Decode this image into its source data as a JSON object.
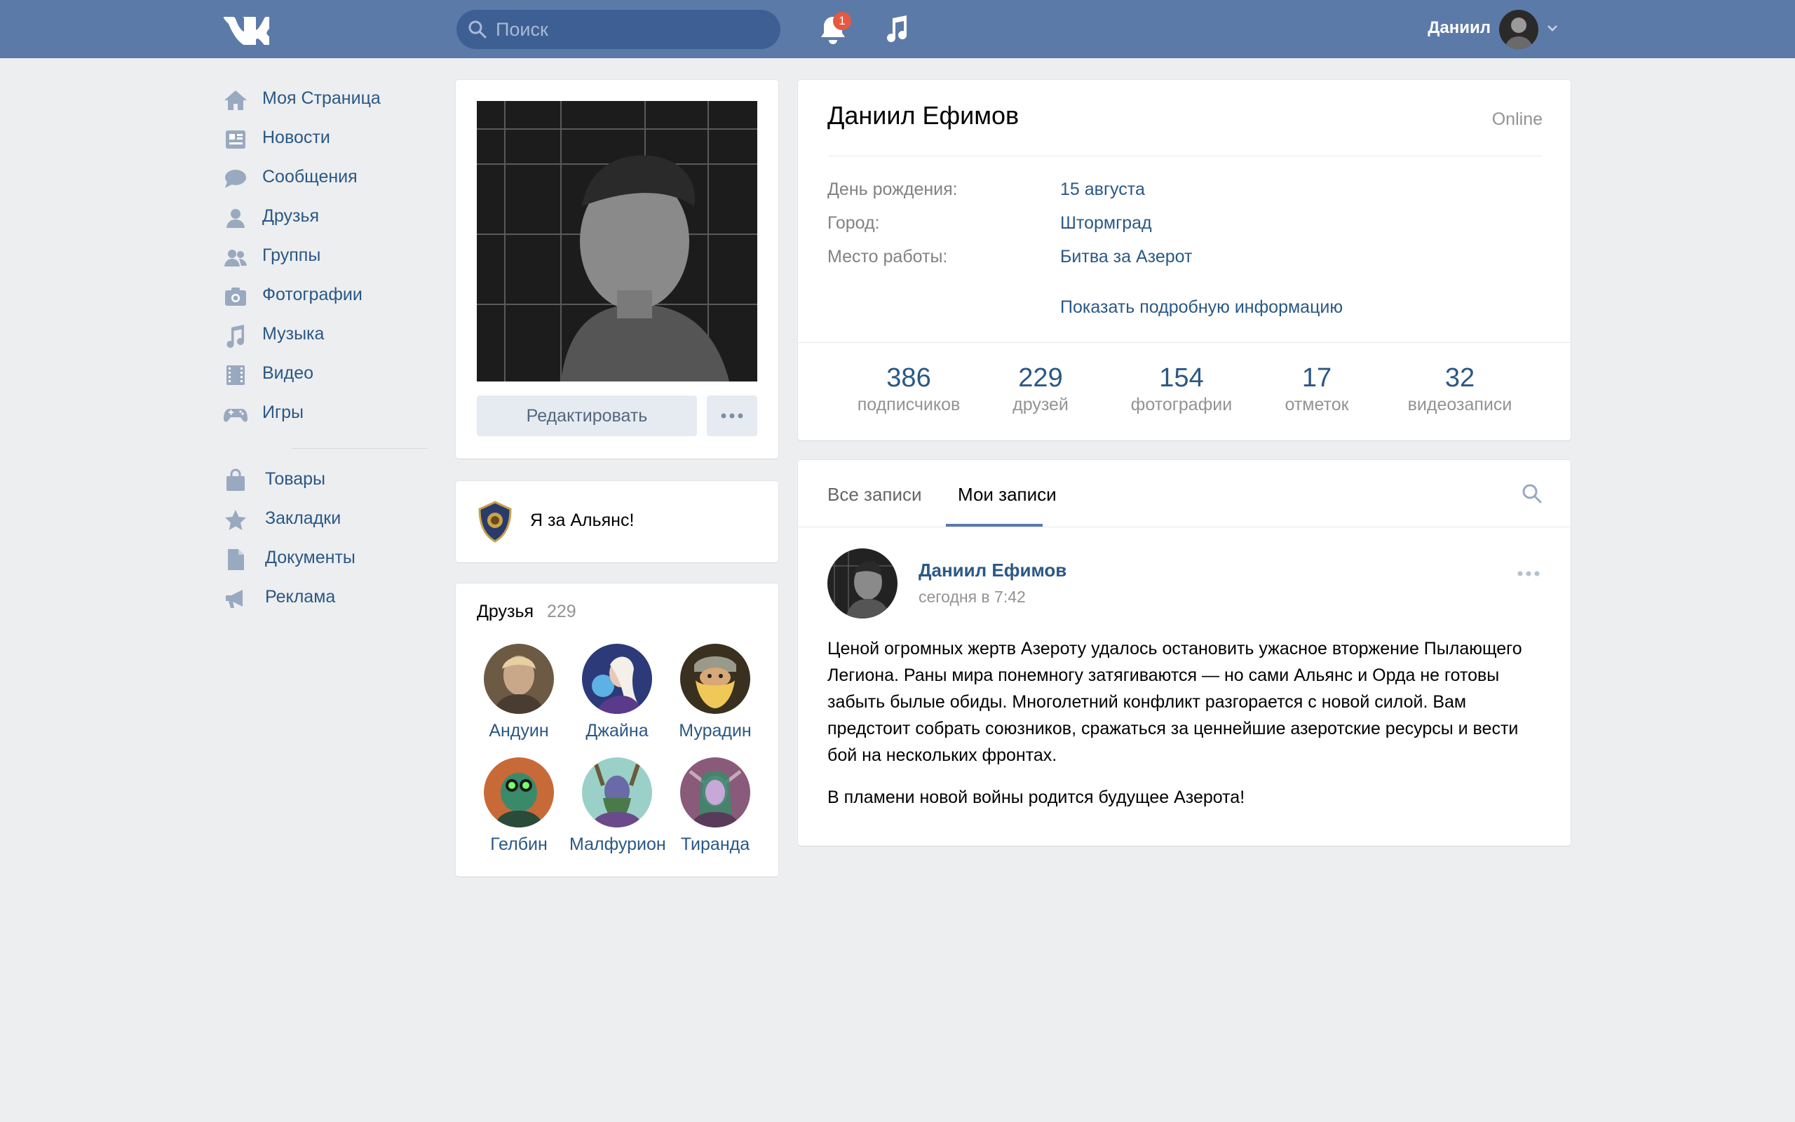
{
  "header": {
    "search_placeholder": "Поиск",
    "notifications_count": "1",
    "user_name": "Даниил",
    "icons": [
      "vk-logo-icon",
      "search-icon",
      "bell-icon",
      "music-icon",
      "chevron-down-icon"
    ],
    "colors": {
      "bar": "#5b7aa8",
      "search_bg": "#3e5f93",
      "badge": "#e55940"
    }
  },
  "nav": {
    "items": [
      {
        "label": "Моя Страница",
        "icon": "home-icon"
      },
      {
        "label": "Новости",
        "icon": "news-icon"
      },
      {
        "label": "Сообщения",
        "icon": "messages-icon"
      },
      {
        "label": "Друзья",
        "icon": "user-icon"
      },
      {
        "label": "Группы",
        "icon": "groups-icon"
      },
      {
        "label": "Фотографии",
        "icon": "camera-icon"
      },
      {
        "label": "Музыка",
        "icon": "music-icon"
      },
      {
        "label": "Видео",
        "icon": "film-icon"
      },
      {
        "label": "Игры",
        "icon": "gamepad-icon"
      }
    ],
    "extra_items": [
      {
        "label": "Товары",
        "icon": "bag-icon"
      },
      {
        "label": "Закладки",
        "icon": "star-icon"
      },
      {
        "label": "Документы",
        "icon": "document-icon"
      },
      {
        "label": "Реклама",
        "icon": "megaphone-icon"
      }
    ]
  },
  "profile": {
    "edit_label": "Редактировать",
    "status_prefix": "Я за ",
    "status_bold": "Альянс!",
    "name": "Даниил Ефимов",
    "online": "Online",
    "info": [
      {
        "key": "День рождения:",
        "value": "15 августа"
      },
      {
        "key": "Город:",
        "value": "Штормград"
      },
      {
        "key": "Место работы:",
        "value": "Битва за Азерот"
      }
    ],
    "show_more": "Показать подробную информацию",
    "counters": [
      {
        "num": "386",
        "label": "подписчиков"
      },
      {
        "num": "229",
        "label": "друзей"
      },
      {
        "num": "154",
        "label": "фотографии"
      },
      {
        "num": "17",
        "label": "отметок"
      },
      {
        "num": "32",
        "label": "видеозаписи"
      }
    ]
  },
  "friends": {
    "title": "Друзья",
    "count": "229",
    "list": [
      {
        "name": "Андуин",
        "color": "#8a6a4a"
      },
      {
        "name": "Джайна",
        "color": "#3a4a9a"
      },
      {
        "name": "Мурадин",
        "color": "#a8793a"
      },
      {
        "name": "Гелбин",
        "color": "#2f7a5a"
      },
      {
        "name": "Малфурион",
        "color": "#7ab0a0"
      },
      {
        "name": "Тиранда",
        "color": "#8a6a9a"
      }
    ]
  },
  "wall": {
    "tab_all": "Все записи",
    "tab_mine": "Мои записи",
    "post": {
      "author": "Даниил Ефимов",
      "time": "сегодня в 7:42",
      "paragraph1": "Ценой огромных жертв Азероту удалось остановить ужасное вторжение Пылающего Легиона. Раны мира понемногу затягиваются — но сами Альянс и Орда не готовы забыть былые обиды. Многолетний конфликт разгорается с новой силой. Вам предстоит собрать союзников, сражаться за ценнейшие азеротские ресурсы и вести бой на нескольких фронтах.",
      "paragraph2": "В пламени новой войны родится будущее Азерота!"
    }
  }
}
